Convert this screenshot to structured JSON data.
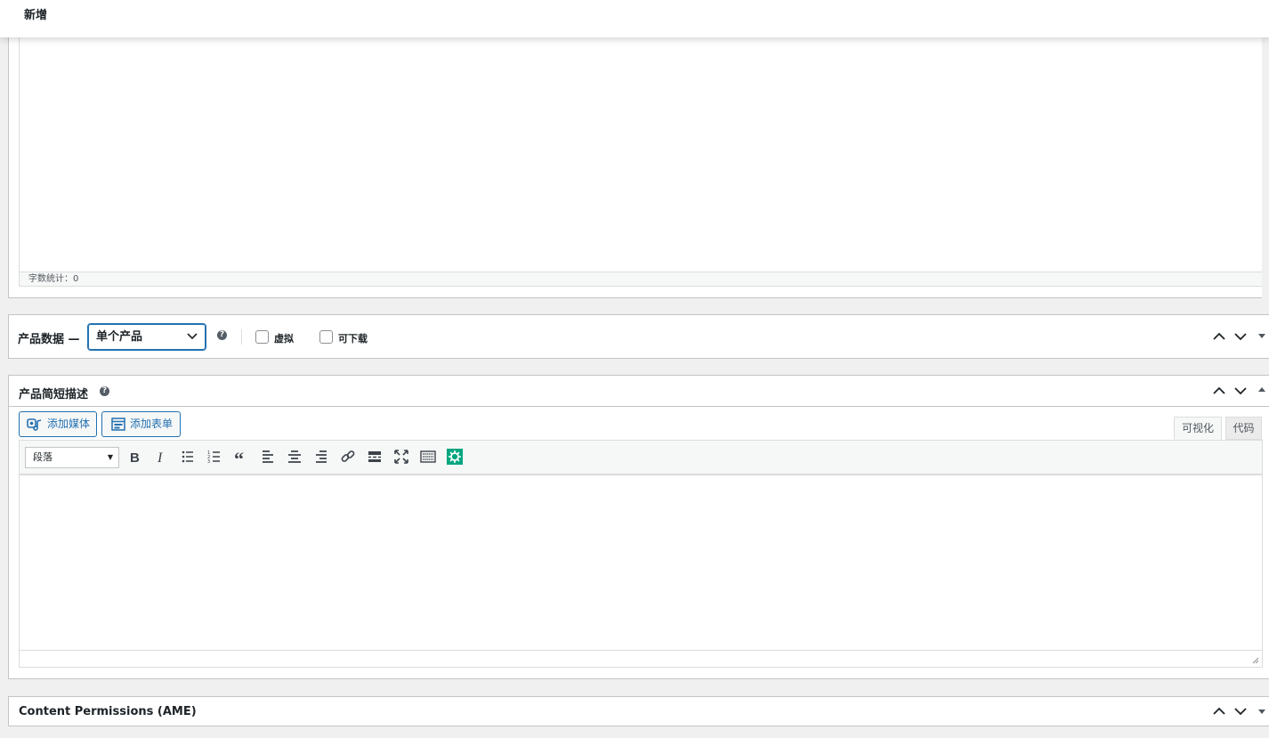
{
  "header": {
    "title": "新增"
  },
  "content_editor": {
    "word_count_label": "字数统计：0"
  },
  "product_data": {
    "title": "产品数据 —",
    "product_type": "单个产品",
    "virtual_label": "虚拟",
    "downloadable_label": "可下载",
    "help_icon": "question-circle-icon"
  },
  "short_description": {
    "title": "产品简短描述",
    "add_media_label": "添加媒体",
    "add_form_label": "添加表单",
    "tab_visual": "可视化",
    "tab_code": "代码",
    "format_select": "段落",
    "toolbar_icons": [
      "bold-icon",
      "italic-icon",
      "bullet-list-icon",
      "numbered-list-icon",
      "blockquote-icon",
      "align-left-icon",
      "align-center-icon",
      "align-right-icon",
      "link-icon",
      "read-more-icon",
      "fullscreen-icon",
      "toolbar-toggle-icon",
      "plugin-gear-icon"
    ]
  },
  "content_permissions": {
    "title": "Content Permissions (AME)"
  },
  "colors": {
    "accent": "#2271b1",
    "plugin_green": "#00a67e"
  }
}
